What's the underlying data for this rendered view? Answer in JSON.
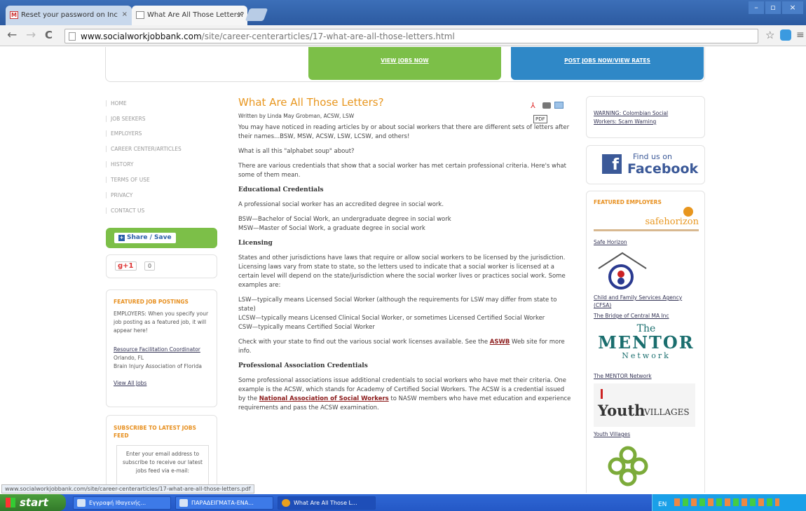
{
  "browser": {
    "tabs": [
      {
        "label": "Reset your password on Inc",
        "active": false,
        "icon": "gmail-icon"
      },
      {
        "label": "What Are All Those Letters?",
        "active": true,
        "icon": "page-icon"
      }
    ],
    "url_domain": "www.socialworkjobbank.com",
    "url_path": "/site/career-centerarticles/17-what-are-all-those-letters.html"
  },
  "banners": {
    "view_jobs": "VIEW JOBS NOW",
    "post_jobs": "POST JOBS NOW/VIEW RATES"
  },
  "nav": {
    "items": [
      "HOME",
      "JOB SEEKERS",
      "EMPLOYERS",
      "CAREER CENTER/ARTICLES",
      "HISTORY",
      "TERMS OF USE",
      "PRIVACY",
      "CONTACT US"
    ]
  },
  "share": {
    "label": "Share / Save",
    "gplus_label": "+1",
    "gplus_count": "0"
  },
  "featured": {
    "heading": "FEATURED JOB POSTINGS",
    "intro": "EMPLOYERS: When you specify your job posting as a featured job, it will appear here!",
    "job_title": "Resource Facilitation Coordinator",
    "job_location": "Orlando, FL",
    "job_org": "Brain Injury Association of Florida",
    "view_all": "View All Jobs"
  },
  "subscribe": {
    "heading": "SUBSCRIBE TO LATEST JOBS FEED",
    "text": "Enter your email address to subscribe to receive our latest jobs feed via e-mail:"
  },
  "article": {
    "title": "What Are All Those Letters?",
    "byline": "Written by Linda May Grobman, ACSW, LSW",
    "pdf_label": "PDF",
    "p1": "You may have noticed in reading articles by or about social workers that there are different sets of letters after their names...BSW, MSW, ACSW, LSW, LCSW, and others!",
    "p2": "What is all this \"alphabet soup\" about?",
    "p3": "There are various credentials that show that a social worker has met certain professional criteria. Here's what some of them mean.",
    "h1": "Educational Credentials",
    "p4": "A professional social worker has an accredited degree in social work.",
    "bsw": "BSW—Bachelor of Social Work, an undergraduate degree in social work",
    "msw": "MSW—Master of Social Work, a graduate degree in social work",
    "h2": "Licensing",
    "p5": "States and other jurisdictions have laws that require or allow social workers to be licensed by the jurisdiction. Licensing laws vary from state to state, so the letters used to indicate that a social worker is licensed at a certain level will depend on the state/jurisdiction where the social worker lives or practices social work. Some examples are:",
    "lsw": "LSW—typically means Licensed Social Worker (although the requirements for LSW may differ from state to state)",
    "lcsw": "LCSW—typically means Licensed Clinical Social Worker, or sometimes Licensed Certified Social Worker",
    "csw": "CSW—typically means Certified Social Worker",
    "p6_a": "Check with your state to find out the various social work licenses available. See the ",
    "p6_link": "ASWB",
    "p6_b": " Web site for more info.",
    "h3": "Professional Association Credentials",
    "p7_a": "Some professional associations issue additional credentials to social workers who have met their criteria. One example is the ACSW, which stands for Academy of Certified Social Workers. The ACSW is a credential issued by the ",
    "p7_link": "National Association of Social Workers",
    "p7_b": " to NASW members who have met education and experience requirements and pass the ACSW examination."
  },
  "rightcol": {
    "warning": "WARNING: Colombian Social Workers: Scam Warning",
    "fb_find": "Find us on",
    "fb_name": "Facebook",
    "employers_heading": "FEATURED EMPLOYERS",
    "safehorizon_logo": "safehorizon",
    "safehorizon": "Safe Horizon",
    "childfamily": "Child and Family Services Agency (CFSA)",
    "bridge": "The Bridge of Central MA Inc",
    "mentor_the": "The",
    "mentor_word": "MENTOR",
    "mentor_net": "Network",
    "mentor": "The MENTOR Network",
    "youth_big": "Youth",
    "youth_small": "VILLAGES",
    "youth": "Youth Villages"
  },
  "status_url": "www.socialworkjobbank.com/site/career-centerarticles/17-what-are-all-those-letters.pdf",
  "taskbar": {
    "start": "start",
    "tasks": [
      "Εγγραφή Ιθαγενής...",
      "ΠΑΡΑΔΕΙΓΜΑΤΑ-ΕΝΑ...",
      "What Are All Those L..."
    ],
    "tray_lang": "EN"
  },
  "colors": {
    "green": "#7cbf48",
    "blue": "#2f88c7",
    "orange": "#e8961e",
    "link_red": "#8b1a1a"
  }
}
